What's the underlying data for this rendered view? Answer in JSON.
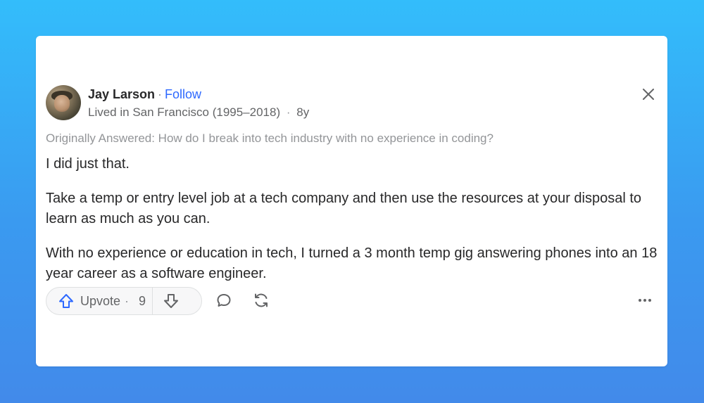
{
  "author": {
    "name": "Jay Larson",
    "separator": "·",
    "follow_label": "Follow",
    "credential": "Lived in San Francisco (1995–2018)",
    "meta_separator": "·",
    "age": "8y"
  },
  "originally_answered": "Originally Answered: How do I break into tech industry with no experience in coding?",
  "answer": {
    "paragraphs": [
      "I did just that.",
      "Take a temp or entry level job at a tech company and then use the resources at your disposal to learn as much as you can.",
      "With no experience or education in tech, I turned a 3 month temp gig answering phones into an 18 year career as a software engineer."
    ]
  },
  "actions": {
    "upvote_label": "Upvote",
    "upvote_separator": "·",
    "upvote_count": "9",
    "icons": {
      "upvote": "arrow-up-icon",
      "downvote": "arrow-down-icon",
      "comment": "comment-icon",
      "share": "reshare-icon",
      "more": "more-icon",
      "close": "close-icon"
    }
  },
  "colors": {
    "background_top": "#33bdfb",
    "background_bottom": "#428aea",
    "link": "#2e69ff",
    "text": "#282829",
    "muted": "#939598"
  }
}
